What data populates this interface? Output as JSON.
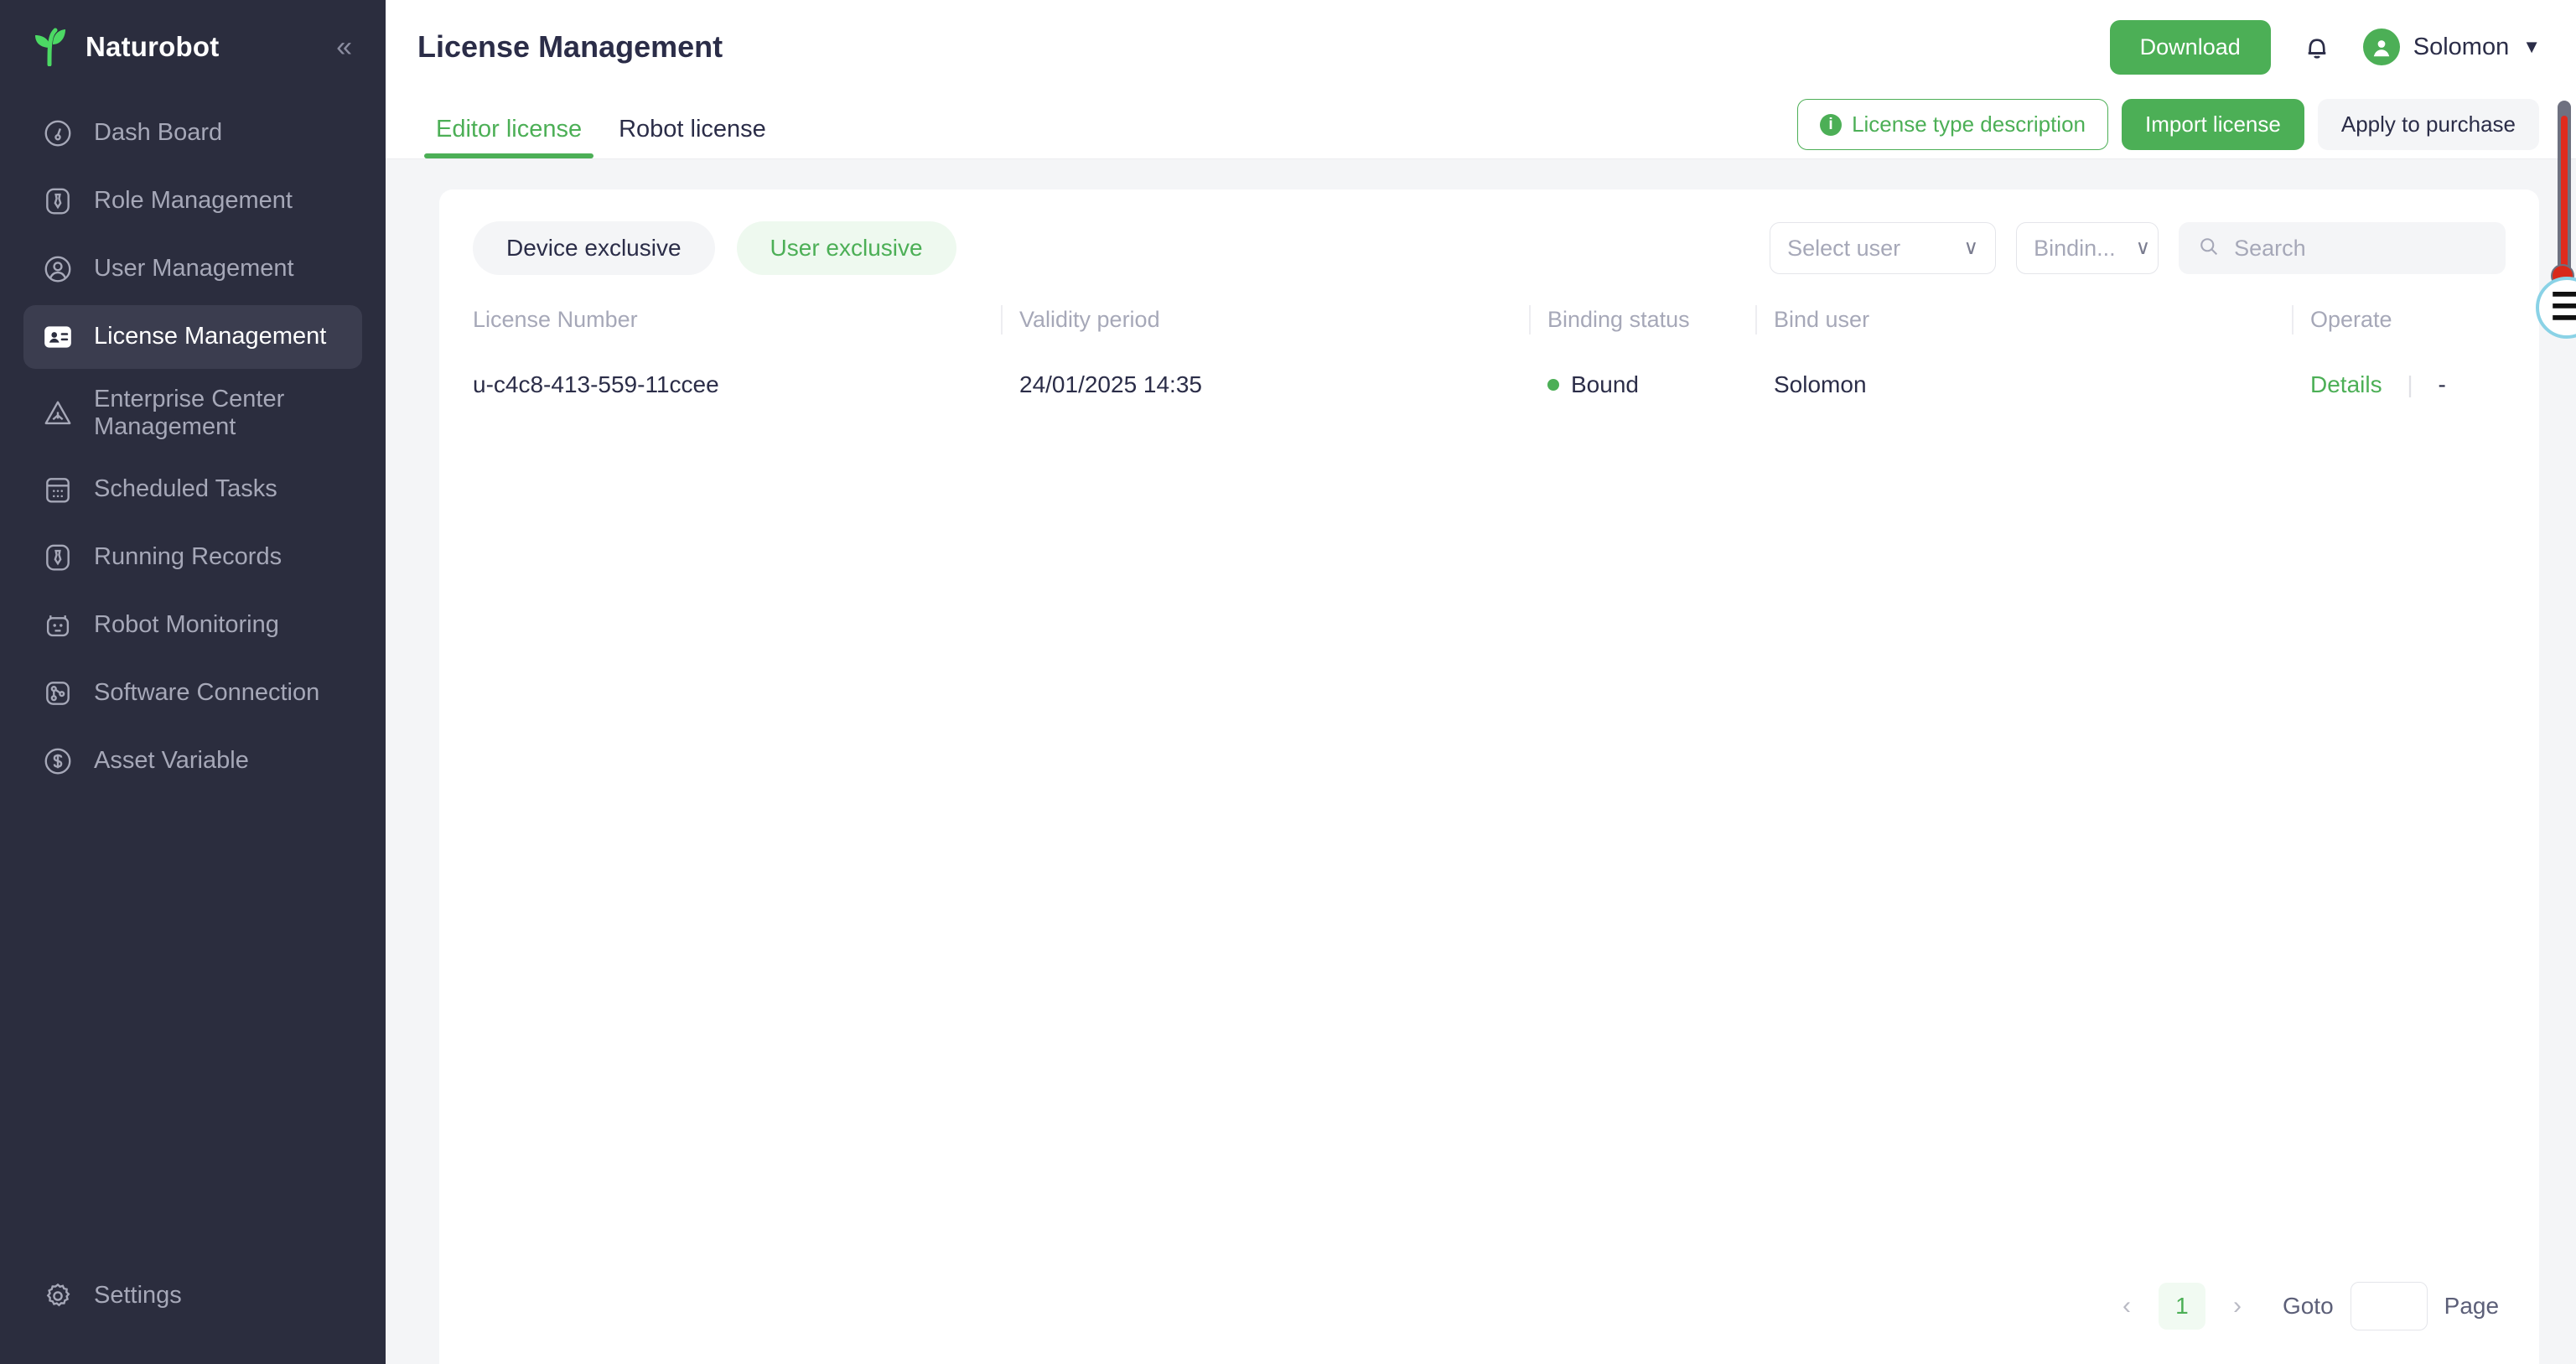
{
  "brand": {
    "name": "Naturobot",
    "logo_icon": "leaf-sprout-icon",
    "collapse_icon": "chevron-double-left-icon"
  },
  "sidebar": {
    "items": [
      {
        "label": "Dash Board",
        "icon": "gauge-icon",
        "active": false
      },
      {
        "label": "Role Management",
        "icon": "necktie-icon",
        "active": false
      },
      {
        "label": "User Management",
        "icon": "user-circle-icon",
        "active": false
      },
      {
        "label": "License Management",
        "icon": "id-card-icon",
        "active": true
      },
      {
        "label": "Enterprise Center Management",
        "icon": "triangle-alert-icon",
        "active": false
      },
      {
        "label": "Scheduled Tasks",
        "icon": "calendar-icon",
        "active": false
      },
      {
        "label": "Running Records",
        "icon": "necktie-icon",
        "active": false
      },
      {
        "label": "Robot Monitoring",
        "icon": "robot-icon",
        "active": false
      },
      {
        "label": "Software Connection",
        "icon": "node-graph-icon",
        "active": false
      },
      {
        "label": "Asset Variable",
        "icon": "dollar-circle-icon",
        "active": false
      }
    ],
    "bottom": {
      "label": "Settings",
      "icon": "gear-icon"
    }
  },
  "header": {
    "title": "License Management",
    "download_label": "Download",
    "bell_icon": "bell-icon",
    "avatar_icon": "user-avatar-icon",
    "user_name": "Solomon",
    "caret_icon": "caret-down-icon"
  },
  "tabs": [
    {
      "label": "Editor license",
      "active": true
    },
    {
      "label": "Robot license",
      "active": false
    }
  ],
  "tab_actions": {
    "license_type_description": "License type description",
    "info_icon": "info-icon",
    "import_license": "Import license",
    "apply_to_purchase": "Apply to purchase"
  },
  "filters": {
    "chips": [
      {
        "label": "Device exclusive",
        "style": "grey"
      },
      {
        "label": "User exclusive",
        "style": "green"
      }
    ],
    "select_user": {
      "value": "Select user",
      "chevron_icon": "chevron-down-icon"
    },
    "binding_status": {
      "value": "Bindin...",
      "chevron_icon": "chevron-down-icon"
    },
    "search": {
      "placeholder": "Search",
      "value": "",
      "icon": "search-icon"
    }
  },
  "table": {
    "columns": [
      "License Number",
      "Validity period",
      "Binding status",
      "Bind user",
      "Operate"
    ],
    "rows": [
      {
        "license_number": "u-c4c8-413-559-11ccee",
        "validity_period": "24/01/2025 14:35",
        "binding_status": "Bound",
        "bind_user": "Solomon",
        "operate_details": "Details",
        "operate_extra": "-"
      }
    ]
  },
  "pagination": {
    "prev_icon": "chevron-left-icon",
    "next_icon": "chevron-right-icon",
    "current_page": "1",
    "goto_label": "Goto",
    "goto_value": "",
    "page_label": "Page"
  },
  "colors": {
    "accent_green": "#4caf56",
    "sidebar_bg": "#2b2d3e",
    "sidebar_active_bg": "#3b3d4f",
    "page_bg": "#f4f5f7",
    "text_dark": "#2b2d48",
    "text_muted": "#a6a8b8",
    "status_bound": "#4caf56",
    "scrollbar_red": "#e02b1d"
  },
  "edge_widgets": {
    "scrollbar_name": "vertical-scrollbar",
    "badge_icon": "circular-gradient-badge-icon"
  }
}
